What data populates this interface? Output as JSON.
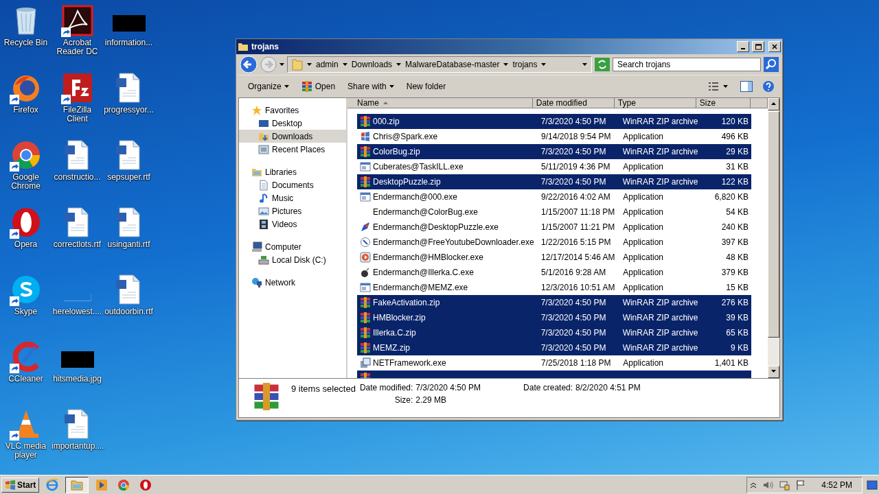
{
  "desktop_icons": [
    {
      "label": "Recycle Bin",
      "kind": "recycle",
      "shortcut": false
    },
    {
      "label": "Firefox",
      "kind": "firefox",
      "shortcut": true
    },
    {
      "label": "Google Chrome",
      "kind": "chrome",
      "shortcut": true
    },
    {
      "label": "Opera",
      "kind": "opera",
      "shortcut": true
    },
    {
      "label": "Skype",
      "kind": "skype",
      "shortcut": true
    },
    {
      "label": "CCleaner",
      "kind": "ccleaner",
      "shortcut": true
    },
    {
      "label": "VLC media player",
      "kind": "vlc",
      "shortcut": true
    },
    {
      "label": "Acrobat Reader DC",
      "kind": "acrobat",
      "shortcut": true
    },
    {
      "label": "FileZilla Client",
      "kind": "filezilla",
      "shortcut": true
    },
    {
      "label": "constructio...",
      "kind": "doc",
      "shortcut": false
    },
    {
      "label": "correctlots.rtf",
      "kind": "doc",
      "shortcut": false
    },
    {
      "label": "herelowest....",
      "kind": "blank",
      "shortcut": false
    },
    {
      "label": "hitsmedia.jpg",
      "kind": "redacted",
      "shortcut": false
    },
    {
      "label": "importantup....",
      "kind": "doc",
      "shortcut": false
    },
    {
      "label": "information...",
      "kind": "redacted",
      "shortcut": false
    },
    {
      "label": "progressyor...",
      "kind": "doc",
      "shortcut": false
    },
    {
      "label": "sepsuper.rtf",
      "kind": "doc",
      "shortcut": false
    },
    {
      "label": "usinganti.rtf",
      "kind": "doc",
      "shortcut": false
    },
    {
      "label": "outdoorbin.rtf",
      "kind": "doc",
      "shortcut": false
    }
  ],
  "window": {
    "title": "trojans",
    "breadcrumbs": [
      "admin",
      "Downloads",
      "MalwareDatabase-master",
      "trojans"
    ],
    "search": {
      "placeholder": "Search trojans"
    },
    "toolbar": [
      {
        "label": "Organize",
        "kind": "menu"
      },
      {
        "label": "Open",
        "kind": "open"
      },
      {
        "label": "Share with",
        "kind": "menu"
      },
      {
        "label": "New folder",
        "kind": "plain"
      }
    ],
    "nav": [
      {
        "label": "Favorites",
        "kind": "star",
        "selected": false,
        "children": [
          {
            "label": "Desktop",
            "kind": "desktop",
            "selected": false
          },
          {
            "label": "Downloads",
            "kind": "downloads",
            "selected": true
          },
          {
            "label": "Recent Places",
            "kind": "recent",
            "selected": false
          }
        ]
      },
      {
        "label": "Libraries",
        "kind": "library",
        "selected": false,
        "children": [
          {
            "label": "Documents",
            "kind": "documents",
            "selected": false
          },
          {
            "label": "Music",
            "kind": "music",
            "selected": false
          },
          {
            "label": "Pictures",
            "kind": "pictures",
            "selected": false
          },
          {
            "label": "Videos",
            "kind": "videos",
            "selected": false
          }
        ]
      },
      {
        "label": "Computer",
        "kind": "computer",
        "selected": false,
        "children": [
          {
            "label": "Local Disk (C:)",
            "kind": "disk",
            "selected": false
          }
        ]
      },
      {
        "label": "Network",
        "kind": "network",
        "selected": false
      }
    ],
    "columns": [
      "Name",
      "Date modified",
      "Type",
      "Size"
    ],
    "rows": [
      {
        "name": "000.zip",
        "date": "7/3/2020 4:50 PM",
        "type": "WinRAR ZIP archive",
        "size": "120 KB",
        "kind": "zip",
        "selected": true
      },
      {
        "name": "Chris@Spark.exe",
        "date": "9/14/2018 9:54 PM",
        "type": "Application",
        "size": "496 KB",
        "kind": "spark",
        "selected": false
      },
      {
        "name": "ColorBug.zip",
        "date": "7/3/2020 4:50 PM",
        "type": "WinRAR ZIP archive",
        "size": "29 KB",
        "kind": "zip",
        "selected": true
      },
      {
        "name": "Cuberates@TaskILL.exe",
        "date": "5/11/2019 4:36 PM",
        "type": "Application",
        "size": "31 KB",
        "kind": "app",
        "selected": false
      },
      {
        "name": "DesktopPuzzle.zip",
        "date": "7/3/2020 4:50 PM",
        "type": "WinRAR ZIP archive",
        "size": "122 KB",
        "kind": "zip",
        "selected": true
      },
      {
        "name": "Endermanch@000.exe",
        "date": "9/22/2016 4:02 AM",
        "type": "Application",
        "size": "6,820 KB",
        "kind": "app",
        "selected": false
      },
      {
        "name": "Endermanch@ColorBug.exe",
        "date": "1/15/2007 11:18 PM",
        "type": "Application",
        "size": "54 KB",
        "kind": "none",
        "selected": false
      },
      {
        "name": "Endermanch@DesktopPuzzle.exe",
        "date": "1/15/2007 11:21 PM",
        "type": "Application",
        "size": "240 KB",
        "kind": "rocket",
        "selected": false
      },
      {
        "name": "Endermanch@FreeYoutubeDownloader.exe",
        "date": "1/22/2016 5:15 PM",
        "type": "Application",
        "size": "397 KB",
        "kind": "circle",
        "selected": false
      },
      {
        "name": "Endermanch@HMBlocker.exe",
        "date": "12/17/2014 5:46 AM",
        "type": "Application",
        "size": "48 KB",
        "kind": "play",
        "selected": false
      },
      {
        "name": "Endermanch@Illerka.C.exe",
        "date": "5/1/2016 9:28 AM",
        "type": "Application",
        "size": "379 KB",
        "kind": "bomb",
        "selected": false
      },
      {
        "name": "Endermanch@MEMZ.exe",
        "date": "12/3/2016 10:51 AM",
        "type": "Application",
        "size": "15 KB",
        "kind": "app",
        "selected": false
      },
      {
        "name": "FakeActivation.zip",
        "date": "7/3/2020 4:50 PM",
        "type": "WinRAR ZIP archive",
        "size": "276 KB",
        "kind": "zip",
        "selected": true
      },
      {
        "name": "HMBlocker.zip",
        "date": "7/3/2020 4:50 PM",
        "type": "WinRAR ZIP archive",
        "size": "39 KB",
        "kind": "zip",
        "selected": true
      },
      {
        "name": "Illerka.C.zip",
        "date": "7/3/2020 4:50 PM",
        "type": "WinRAR ZIP archive",
        "size": "65 KB",
        "kind": "zip",
        "selected": true
      },
      {
        "name": "MEMZ.zip",
        "date": "7/3/2020 4:50 PM",
        "type": "WinRAR ZIP archive",
        "size": "9 KB",
        "kind": "zip",
        "selected": true
      },
      {
        "name": "NETFramework.exe",
        "date": "7/25/2018 1:18 PM",
        "type": "Application",
        "size": "1,401 KB",
        "kind": "net",
        "selected": false
      },
      {
        "kind": "zip",
        "selected": true
      }
    ],
    "details": {
      "count": "9 items selected",
      "fields": [
        {
          "label": "Date modified:",
          "value": "7/3/2020 4:50 PM"
        },
        {
          "label": "Size:",
          "value": "2.29 MB"
        },
        {
          "label": "Date created:",
          "value": "8/2/2020 4:51 PM"
        }
      ]
    }
  },
  "taskbar": {
    "start": "Start",
    "apps": [
      {
        "kind": "ie",
        "active": false
      },
      {
        "kind": "explorer",
        "active": true
      },
      {
        "kind": "media",
        "active": false
      },
      {
        "kind": "chrome",
        "active": false
      },
      {
        "kind": "opera",
        "active": false
      }
    ],
    "clock": "4:52 PM"
  }
}
